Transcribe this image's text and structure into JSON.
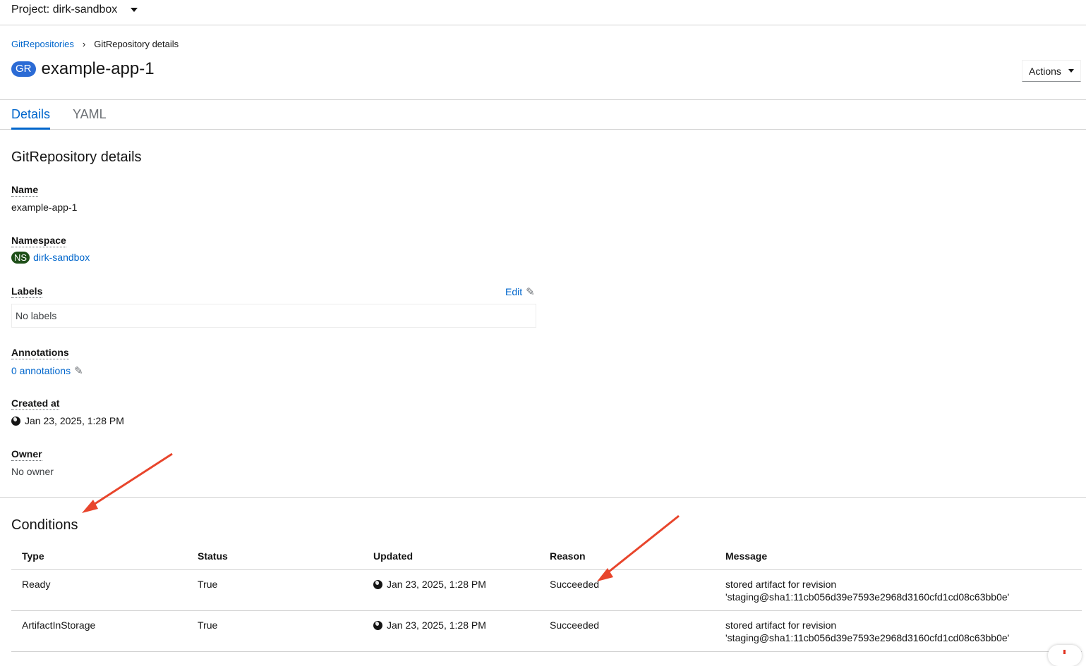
{
  "project": {
    "label": "Project: dirk-sandbox"
  },
  "breadcrumb": {
    "parent": "GitRepositories",
    "separator": "›",
    "current": "GitRepository details"
  },
  "header": {
    "badge": "GR",
    "title": "example-app-1",
    "actions_label": "Actions"
  },
  "tabs": [
    {
      "label": "Details",
      "active": true
    },
    {
      "label": "YAML",
      "active": false
    }
  ],
  "details": {
    "section_title": "GitRepository details",
    "name_label": "Name",
    "name_value": "example-app-1",
    "namespace_label": "Namespace",
    "namespace_badge": "NS",
    "namespace_value": "dirk-sandbox",
    "labels_label": "Labels",
    "labels_edit": "Edit",
    "labels_value": "No labels",
    "annotations_label": "Annotations",
    "annotations_value": "0 annotations",
    "created_label": "Created at",
    "created_value": "Jan 23, 2025, 1:28 PM",
    "owner_label": "Owner",
    "owner_value": "No owner"
  },
  "conditions": {
    "section_title": "Conditions",
    "columns": [
      "Type",
      "Status",
      "Updated",
      "Reason",
      "Message"
    ],
    "rows": [
      {
        "type": "Ready",
        "status": "True",
        "updated": "Jan 23, 2025, 1:28 PM",
        "reason": "Succeeded",
        "message_line1": "stored artifact for revision",
        "message_line2": "'staging@sha1:11cb056d39e7593e2968d3160cfd1cd08c63bb0e'"
      },
      {
        "type": "ArtifactInStorage",
        "status": "True",
        "updated": "Jan 23, 2025, 1:28 PM",
        "reason": "Succeeded",
        "message_line1": "stored artifact for revision",
        "message_line2": "'staging@sha1:11cb056d39e7593e2968d3160cfd1cd08c63bb0e'"
      }
    ]
  },
  "annotation_arrow_color": "#e8452c",
  "colors": {
    "link": "#0066cc",
    "gr_badge": "#2b6bd5",
    "ns_badge": "#1e4f18"
  }
}
